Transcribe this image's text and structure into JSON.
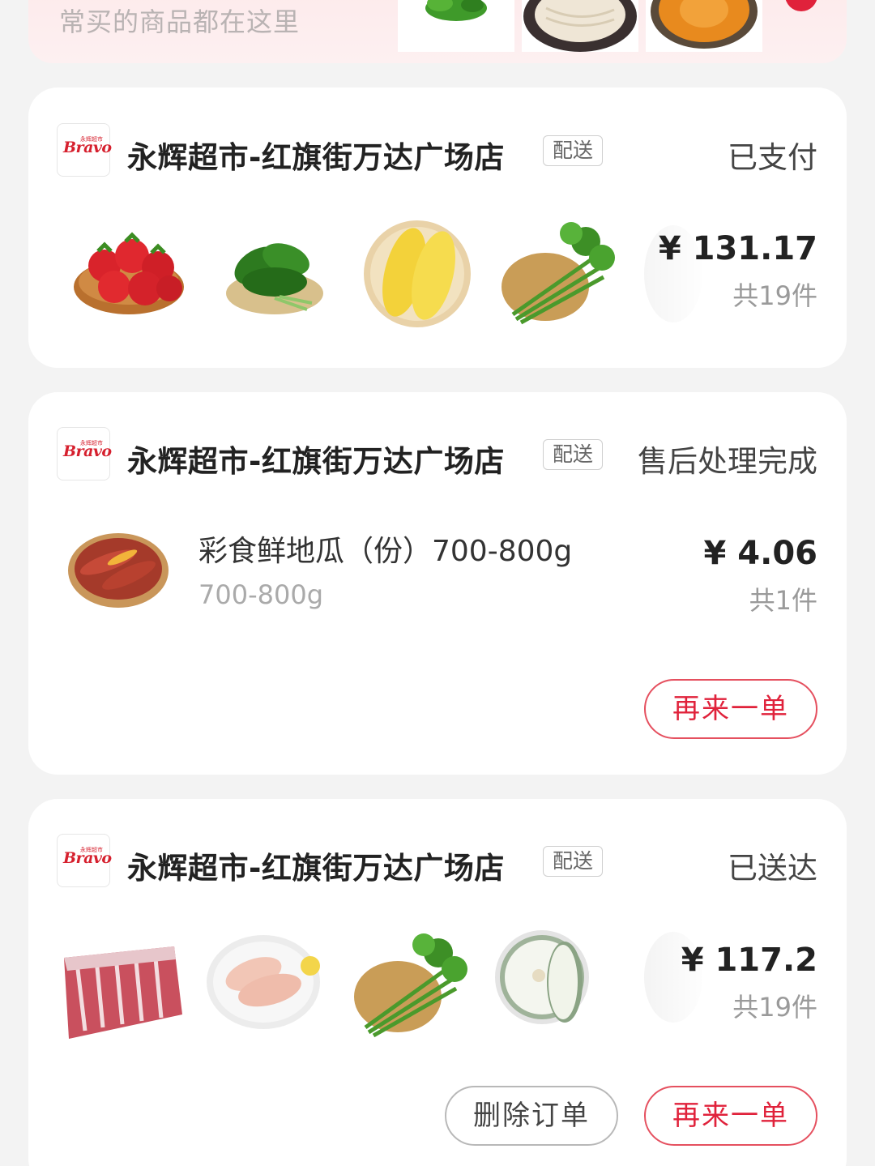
{
  "banner": {
    "subtitle": "常买的商品都在这里",
    "thumbs": [
      "cilantro-thumb",
      "noodles-thumb",
      "pumpkin-thumb"
    ]
  },
  "orders": [
    {
      "logo_text": "Bravo",
      "logo_cn": "永辉超市",
      "store": "永辉超市-红旗街万达广场店",
      "tag": "配送",
      "status": "已支付",
      "items": [
        "strawberries",
        "spinach",
        "corn",
        "celery",
        "more"
      ],
      "price": "¥ 131.17",
      "count": "共19件"
    },
    {
      "logo_text": "Bravo",
      "logo_cn": "永辉超市",
      "store": "永辉超市-红旗街万达广场店",
      "tag": "配送",
      "status": "售后处理完成",
      "item_name": "彩食鲜地瓜（份）700-800g",
      "item_spec": "700-800g",
      "price": "¥ 4.06",
      "count": "共1件",
      "reorder_label": "再来一单"
    },
    {
      "logo_text": "Bravo",
      "logo_cn": "永辉超市",
      "store": "永辉超市-红旗街万达广场店",
      "tag": "配送",
      "status": "已送达",
      "items": [
        "lamb-ribs",
        "chicken-breast",
        "celery",
        "winter-melon",
        "more"
      ],
      "price": "¥ 117.2",
      "count": "共19件",
      "delete_label": "删除订单",
      "reorder_label": "再来一单"
    }
  ],
  "colors": {
    "accent": "#e0223b",
    "background": "#f3f3f3",
    "card": "#ffffff",
    "banner": "#fde9ea"
  }
}
